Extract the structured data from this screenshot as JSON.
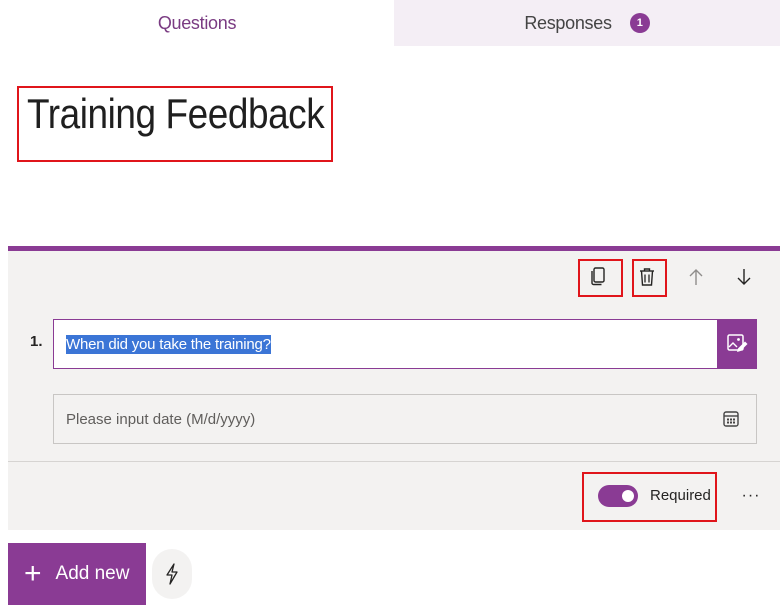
{
  "tabs": {
    "questions_label": "Questions",
    "responses_label": "Responses",
    "responses_count": "1"
  },
  "form": {
    "title": "Training Feedback"
  },
  "question": {
    "number": "1.",
    "text": "When did you take the training?",
    "date_placeholder": "Please input date (M/d/yyyy)",
    "required_label": "Required",
    "required": true,
    "more_label": "···"
  },
  "toolbar": {
    "icons": [
      "copy-icon",
      "delete-icon",
      "arrow-up-icon",
      "arrow-down-icon"
    ]
  },
  "bottom": {
    "add_new_label": "Add new"
  },
  "colors": {
    "accent": "#8a3b94",
    "highlight": "#e0151b",
    "selection": "#3b75d6"
  }
}
